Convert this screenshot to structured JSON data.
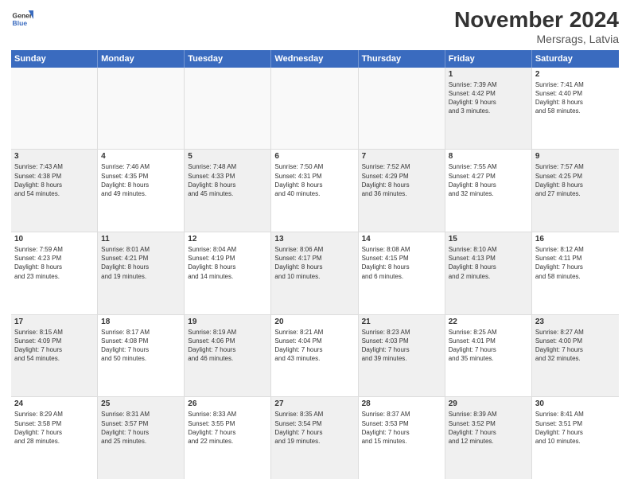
{
  "logo": {
    "line1": "General",
    "line2": "Blue"
  },
  "title": "November 2024",
  "location": "Mersrags, Latvia",
  "days_of_week": [
    "Sunday",
    "Monday",
    "Tuesday",
    "Wednesday",
    "Thursday",
    "Friday",
    "Saturday"
  ],
  "weeks": [
    [
      {
        "day": "",
        "info": "",
        "empty": true
      },
      {
        "day": "",
        "info": "",
        "empty": true
      },
      {
        "day": "",
        "info": "",
        "empty": true
      },
      {
        "day": "",
        "info": "",
        "empty": true
      },
      {
        "day": "",
        "info": "",
        "empty": true
      },
      {
        "day": "1",
        "info": "Sunrise: 7:39 AM\nSunset: 4:42 PM\nDaylight: 9 hours\nand 3 minutes.",
        "shaded": true
      },
      {
        "day": "2",
        "info": "Sunrise: 7:41 AM\nSunset: 4:40 PM\nDaylight: 8 hours\nand 58 minutes.",
        "shaded": false
      }
    ],
    [
      {
        "day": "3",
        "info": "Sunrise: 7:43 AM\nSunset: 4:38 PM\nDaylight: 8 hours\nand 54 minutes.",
        "shaded": true
      },
      {
        "day": "4",
        "info": "Sunrise: 7:46 AM\nSunset: 4:35 PM\nDaylight: 8 hours\nand 49 minutes.",
        "shaded": false
      },
      {
        "day": "5",
        "info": "Sunrise: 7:48 AM\nSunset: 4:33 PM\nDaylight: 8 hours\nand 45 minutes.",
        "shaded": true
      },
      {
        "day": "6",
        "info": "Sunrise: 7:50 AM\nSunset: 4:31 PM\nDaylight: 8 hours\nand 40 minutes.",
        "shaded": false
      },
      {
        "day": "7",
        "info": "Sunrise: 7:52 AM\nSunset: 4:29 PM\nDaylight: 8 hours\nand 36 minutes.",
        "shaded": true
      },
      {
        "day": "8",
        "info": "Sunrise: 7:55 AM\nSunset: 4:27 PM\nDaylight: 8 hours\nand 32 minutes.",
        "shaded": false
      },
      {
        "day": "9",
        "info": "Sunrise: 7:57 AM\nSunset: 4:25 PM\nDaylight: 8 hours\nand 27 minutes.",
        "shaded": true
      }
    ],
    [
      {
        "day": "10",
        "info": "Sunrise: 7:59 AM\nSunset: 4:23 PM\nDaylight: 8 hours\nand 23 minutes.",
        "shaded": false
      },
      {
        "day": "11",
        "info": "Sunrise: 8:01 AM\nSunset: 4:21 PM\nDaylight: 8 hours\nand 19 minutes.",
        "shaded": true
      },
      {
        "day": "12",
        "info": "Sunrise: 8:04 AM\nSunset: 4:19 PM\nDaylight: 8 hours\nand 14 minutes.",
        "shaded": false
      },
      {
        "day": "13",
        "info": "Sunrise: 8:06 AM\nSunset: 4:17 PM\nDaylight: 8 hours\nand 10 minutes.",
        "shaded": true
      },
      {
        "day": "14",
        "info": "Sunrise: 8:08 AM\nSunset: 4:15 PM\nDaylight: 8 hours\nand 6 minutes.",
        "shaded": false
      },
      {
        "day": "15",
        "info": "Sunrise: 8:10 AM\nSunset: 4:13 PM\nDaylight: 8 hours\nand 2 minutes.",
        "shaded": true
      },
      {
        "day": "16",
        "info": "Sunrise: 8:12 AM\nSunset: 4:11 PM\nDaylight: 7 hours\nand 58 minutes.",
        "shaded": false
      }
    ],
    [
      {
        "day": "17",
        "info": "Sunrise: 8:15 AM\nSunset: 4:09 PM\nDaylight: 7 hours\nand 54 minutes.",
        "shaded": true
      },
      {
        "day": "18",
        "info": "Sunrise: 8:17 AM\nSunset: 4:08 PM\nDaylight: 7 hours\nand 50 minutes.",
        "shaded": false
      },
      {
        "day": "19",
        "info": "Sunrise: 8:19 AM\nSunset: 4:06 PM\nDaylight: 7 hours\nand 46 minutes.",
        "shaded": true
      },
      {
        "day": "20",
        "info": "Sunrise: 8:21 AM\nSunset: 4:04 PM\nDaylight: 7 hours\nand 43 minutes.",
        "shaded": false
      },
      {
        "day": "21",
        "info": "Sunrise: 8:23 AM\nSunset: 4:03 PM\nDaylight: 7 hours\nand 39 minutes.",
        "shaded": true
      },
      {
        "day": "22",
        "info": "Sunrise: 8:25 AM\nSunset: 4:01 PM\nDaylight: 7 hours\nand 35 minutes.",
        "shaded": false
      },
      {
        "day": "23",
        "info": "Sunrise: 8:27 AM\nSunset: 4:00 PM\nDaylight: 7 hours\nand 32 minutes.",
        "shaded": true
      }
    ],
    [
      {
        "day": "24",
        "info": "Sunrise: 8:29 AM\nSunset: 3:58 PM\nDaylight: 7 hours\nand 28 minutes.",
        "shaded": false
      },
      {
        "day": "25",
        "info": "Sunrise: 8:31 AM\nSunset: 3:57 PM\nDaylight: 7 hours\nand 25 minutes.",
        "shaded": true
      },
      {
        "day": "26",
        "info": "Sunrise: 8:33 AM\nSunset: 3:55 PM\nDaylight: 7 hours\nand 22 minutes.",
        "shaded": false
      },
      {
        "day": "27",
        "info": "Sunrise: 8:35 AM\nSunset: 3:54 PM\nDaylight: 7 hours\nand 19 minutes.",
        "shaded": true
      },
      {
        "day": "28",
        "info": "Sunrise: 8:37 AM\nSunset: 3:53 PM\nDaylight: 7 hours\nand 15 minutes.",
        "shaded": false
      },
      {
        "day": "29",
        "info": "Sunrise: 8:39 AM\nSunset: 3:52 PM\nDaylight: 7 hours\nand 12 minutes.",
        "shaded": true
      },
      {
        "day": "30",
        "info": "Sunrise: 8:41 AM\nSunset: 3:51 PM\nDaylight: 7 hours\nand 10 minutes.",
        "shaded": false
      }
    ]
  ]
}
